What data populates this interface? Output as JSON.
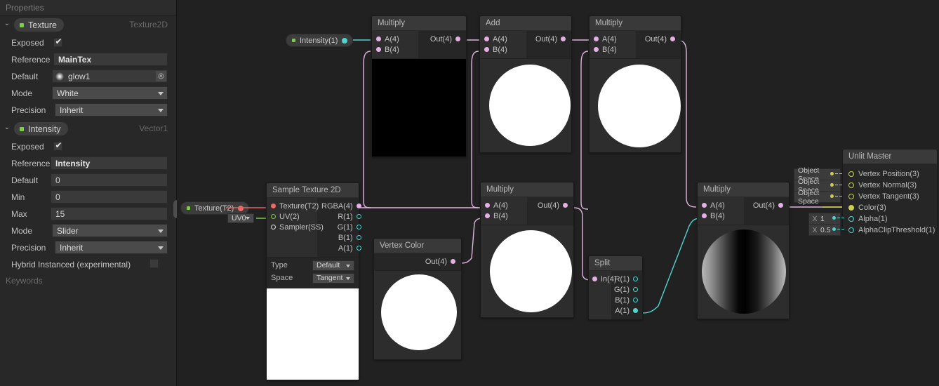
{
  "blackboard": {
    "title": "Properties",
    "keywords_title": "Keywords",
    "properties": [
      {
        "name": "Texture",
        "type": "Texture2D",
        "rows": [
          {
            "label": "Exposed",
            "kind": "checkbox",
            "checked": true
          },
          {
            "label": "Reference",
            "kind": "text",
            "value": "MainTex"
          },
          {
            "label": "Default",
            "kind": "object",
            "value": "glow1"
          },
          {
            "label": "Mode",
            "kind": "dropdown",
            "value": "White"
          },
          {
            "label": "Precision",
            "kind": "dropdown",
            "value": "Inherit"
          }
        ]
      },
      {
        "name": "Intensity",
        "type": "Vector1",
        "rows": [
          {
            "label": "Exposed",
            "kind": "checkbox",
            "checked": true
          },
          {
            "label": "Reference",
            "kind": "text",
            "value": "Intensity"
          },
          {
            "label": "Default",
            "kind": "text",
            "value": "0"
          },
          {
            "label": "Min",
            "kind": "text",
            "value": "0"
          },
          {
            "label": "Max",
            "kind": "text",
            "value": "15"
          },
          {
            "label": "Mode",
            "kind": "dropdown",
            "value": "Slider"
          },
          {
            "label": "Precision",
            "kind": "dropdown",
            "value": "Inherit"
          },
          {
            "label": "Hybrid Instanced (experimental)",
            "kind": "checkbox",
            "checked": false
          }
        ]
      }
    ]
  },
  "graph": {
    "tokens": [
      {
        "id": "token-intensity",
        "label": "Intensity(1)",
        "port_color": "#4fd4cf"
      },
      {
        "id": "token-texture",
        "label": "Texture(T2)",
        "port_color": "#f06a6a"
      }
    ],
    "uv_dropdown": "UV0",
    "nodes": {
      "multiply_1": {
        "title": "Multiply",
        "inputs": [
          "A(4)",
          "B(4)"
        ],
        "outputs": [
          "Out(4)"
        ],
        "preview": "black-square"
      },
      "add_1": {
        "title": "Add",
        "inputs": [
          "A(4)",
          "B(4)"
        ],
        "outputs": [
          "Out(4)"
        ],
        "preview": "white-sphere"
      },
      "multiply_2": {
        "title": "Multiply",
        "inputs": [
          "A(4)",
          "B(4)"
        ],
        "outputs": [
          "Out(4)"
        ],
        "preview": "white-sphere"
      },
      "sample_texture_2d": {
        "title": "Sample Texture 2D",
        "inputs": [
          "Texture(T2)",
          "UV(2)",
          "Sampler(SS)"
        ],
        "outputs": [
          "RGBA(4)",
          "R(1)",
          "G(1)",
          "B(1)",
          "A(1)"
        ],
        "controls": [
          {
            "label": "Type",
            "value": "Default"
          },
          {
            "label": "Space",
            "value": "Tangent"
          }
        ],
        "preview": "white-square"
      },
      "multiply_3": {
        "title": "Multiply",
        "inputs": [
          "A(4)",
          "B(4)"
        ],
        "outputs": [
          "Out(4)"
        ],
        "preview": "white-sphere"
      },
      "vertex_color": {
        "title": "Vertex Color",
        "inputs": [],
        "outputs": [
          "Out(4)"
        ],
        "preview": "white-sphere"
      },
      "split": {
        "title": "Split",
        "inputs": [
          "In(4)"
        ],
        "outputs": [
          "R(1)",
          "G(1)",
          "B(1)",
          "A(1)"
        ]
      },
      "multiply_4": {
        "title": "Multiply",
        "inputs": [
          "A(4)",
          "B(4)"
        ],
        "outputs": [
          "Out(4)"
        ],
        "preview": "gradient-sphere"
      }
    },
    "master": {
      "title": "Unlit Master",
      "slots": [
        {
          "label": "Vertex Position(3)",
          "ext": "Object Space",
          "port": "vec3"
        },
        {
          "label": "Vertex Normal(3)",
          "ext": "Object Space",
          "port": "vec3"
        },
        {
          "label": "Vertex Tangent(3)",
          "ext": "Object Space",
          "port": "vec3"
        },
        {
          "label": "Color(3)",
          "ext": null,
          "port": "vec3-filled"
        },
        {
          "label": "Alpha(1)",
          "ext": null,
          "num": "1",
          "num_axis": "X",
          "port": "vec1"
        },
        {
          "label": "AlphaClipThreshold(1)",
          "ext": null,
          "num": "0.5",
          "num_axis": "X",
          "port": "vec1"
        }
      ]
    }
  },
  "colors": {
    "wire_vec4": "#dfb4df",
    "wire_vec1": "#4fd4cf",
    "wire_vec3": "#cfd04a",
    "wire_texture": "#e06464",
    "wire_uv": "#7ccc47",
    "panel_bg": "#282828",
    "graph_bg": "#212121",
    "node_bg": "#262626",
    "node_title_bg": "#393939",
    "accent_green": "#7ccc47"
  }
}
